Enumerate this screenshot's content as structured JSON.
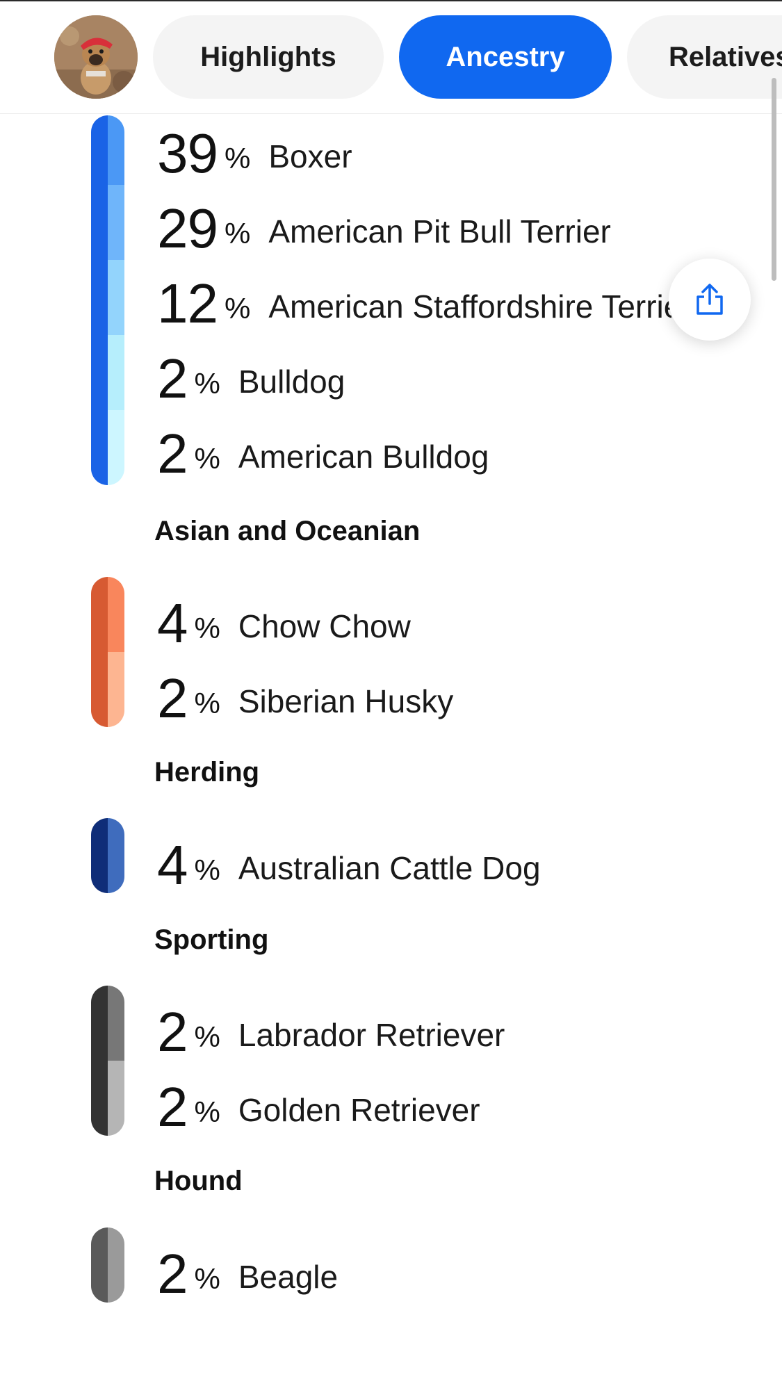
{
  "tabs": [
    {
      "label": "Highlights",
      "active": false
    },
    {
      "label": "Ancestry",
      "active": true
    },
    {
      "label": "Relatives",
      "active": false
    }
  ],
  "colors": {
    "accent": "#1068f0"
  },
  "groups": [
    {
      "title": "",
      "bar_dark": "#1a63e6",
      "breeds": [
        {
          "pct": "39",
          "name": "Boxer",
          "color": "#4b98f5"
        },
        {
          "pct": "29",
          "name": "American Pit Bull Terrier",
          "color": "#6fb5fa"
        },
        {
          "pct": "12",
          "name": "American Staffordshire Terrier",
          "color": "#93d4fc"
        },
        {
          "pct": "2",
          "name": "Bulldog",
          "color": "#b6eefc"
        },
        {
          "pct": "2",
          "name": "American Bulldog",
          "color": "#cdf6ff"
        }
      ]
    },
    {
      "title": "Asian and Oceanian",
      "bar_dark": "#d75a32",
      "breeds": [
        {
          "pct": "4",
          "name": "Chow Chow",
          "color": "#f9865c"
        },
        {
          "pct": "2",
          "name": "Siberian Husky",
          "color": "#fdb591"
        }
      ]
    },
    {
      "title": "Herding",
      "bar_dark": "#0f2d78",
      "breeds": [
        {
          "pct": "4",
          "name": "Australian Cattle Dog",
          "color": "#3f6cbd"
        }
      ]
    },
    {
      "title": "Sporting",
      "bar_dark": "#333333",
      "breeds": [
        {
          "pct": "2",
          "name": "Labrador Retriever",
          "color": "#777777"
        },
        {
          "pct": "2",
          "name": "Golden Retriever",
          "color": "#b5b5b5"
        }
      ]
    },
    {
      "title": "Hound",
      "bar_dark": "#5a5a5a",
      "breeds": [
        {
          "pct": "2",
          "name": "Beagle",
          "color": "#9a9a9a"
        }
      ]
    }
  ],
  "pct_symbol": "%",
  "icons": {
    "share": "share-icon",
    "avatar": "dog-avatar"
  }
}
